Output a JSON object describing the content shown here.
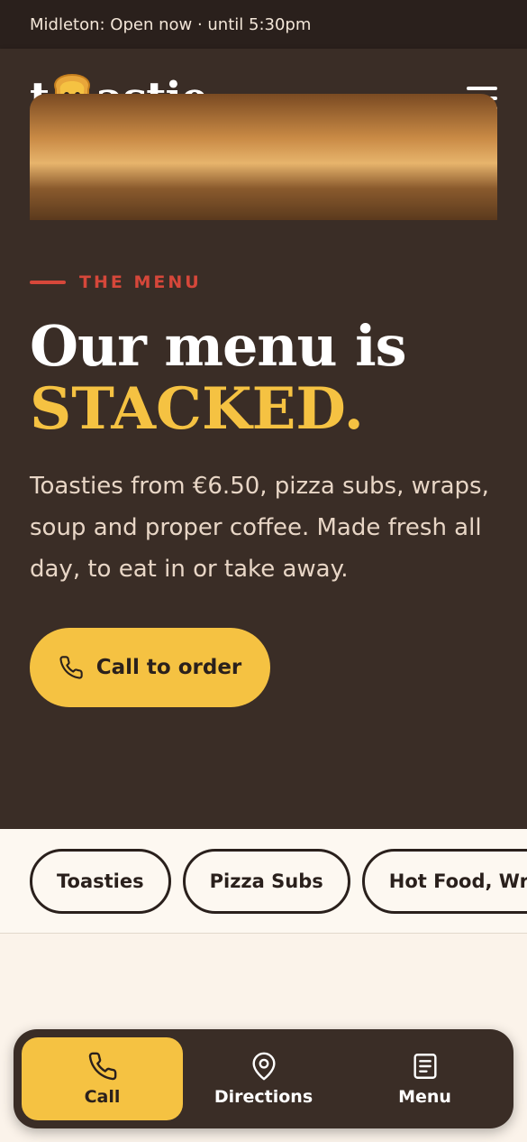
{
  "topbar": {
    "status": "Midleton: Open now · until 5:30pm"
  },
  "header": {
    "logo_pre": "t",
    "logo_post": "astie"
  },
  "hero": {
    "eyebrow": "THE MENU",
    "headline_line1": "Our menu is",
    "headline_line2": "STACKED.",
    "description": "Toasties from €6.50, pizza subs, wraps, soup and proper coffee. Made fresh all day, to eat in or take away.",
    "cta_label": "Call to order"
  },
  "tabs": [
    {
      "label": "Toasties"
    },
    {
      "label": "Pizza Subs"
    },
    {
      "label": "Hot Food, Wraps"
    }
  ],
  "bottom_nav": [
    {
      "label": "Call",
      "icon": "phone-icon",
      "active": true
    },
    {
      "label": "Directions",
      "icon": "map-pin-icon",
      "active": false
    },
    {
      "label": "Menu",
      "icon": "menu-doc-icon",
      "active": false
    }
  ],
  "colors": {
    "brand_dark": "#3a2d26",
    "topbar": "#2a201c",
    "accent_yellow": "#f5c242",
    "accent_red": "#d6473a",
    "cream": "#fbf3ea"
  }
}
